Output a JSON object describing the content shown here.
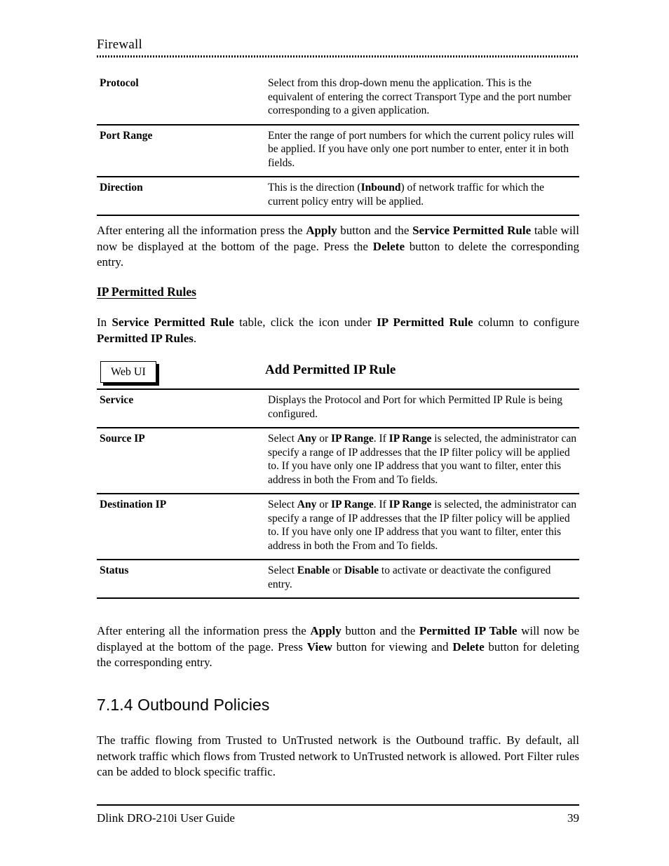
{
  "header": {
    "title": "Firewall"
  },
  "table_one": {
    "rows": [
      {
        "term": "Protocol",
        "desc_html": "Select from this drop-down menu the application. This is the equivalent of entering the correct Transport Type and the port number corresponding to a given application."
      },
      {
        "term": "Port Range",
        "desc_html": "Enter the range of port numbers for which the current policy rules will be applied. If you have only one port number to enter, enter it in both fields."
      },
      {
        "term": "Direction",
        "desc_html": "This is the direction (<b>Inbound</b>) of network traffic for which the current policy entry will be applied."
      }
    ]
  },
  "paragraph_one": {
    "html": "After entering all the information press the <b>Apply</b> button and the <b>Service Permitted Rule</b> table will now be displayed at the bottom of the page. Press the <b>Delete</b> button to delete the corresponding entry."
  },
  "subheading_one": {
    "text": "IP Permitted Rules"
  },
  "paragraph_two": {
    "html": "In <b>Service Permitted Rule</b> table, click the icon under <b>IP Permitted Rule</b> column to configure <b>Permitted IP Rules</b>."
  },
  "webui": {
    "badge_label": "Web UI",
    "title": "Add Permitted IP Rule"
  },
  "table_two": {
    "rows": [
      {
        "term": "Service",
        "desc_html": "Displays the Protocol and Port for which Permitted IP Rule is being configured."
      },
      {
        "term": "Source IP",
        "desc_html": "Select <b>Any</b> or <b>IP Range</b>. If <b>IP Range</b> is selected, the administrator can specify a range of IP addresses that the IP filter policy will be applied to. If you have only one IP address that you want to filter, enter this address in both the From and To fields."
      },
      {
        "term": "Destination IP",
        "desc_html": "Select <b>Any</b> or <b>IP Range</b>. If <b>IP Range</b> is selected, the administrator can specify a range of IP addresses that the IP filter policy will be applied to. If you have only one IP address that you want to filter, enter this address in both the From and To fields."
      },
      {
        "term": "Status",
        "desc_html": "Select <b>Enable</b> or <b>Disable</b> to activate or deactivate the configured entry."
      }
    ]
  },
  "paragraph_three": {
    "html": "After entering all the information press the <b>Apply</b> button and the <b>Permitted IP Table</b> will now be displayed at the bottom of the page. Press <b>View</b> button for viewing and <b>Delete</b> button for deleting the corresponding entry."
  },
  "section_heading": {
    "text": "7.1.4 Outbound Policies"
  },
  "paragraph_four": {
    "html": "The traffic flowing from Trusted to UnTrusted network is the Outbound traffic. By default, all network traffic which flows from Trusted network to UnTrusted network is allowed. Port Filter rules can be added to block specific traffic."
  },
  "footer": {
    "guide_title": "Dlink DRO-210i User Guide",
    "page_number": "39"
  }
}
